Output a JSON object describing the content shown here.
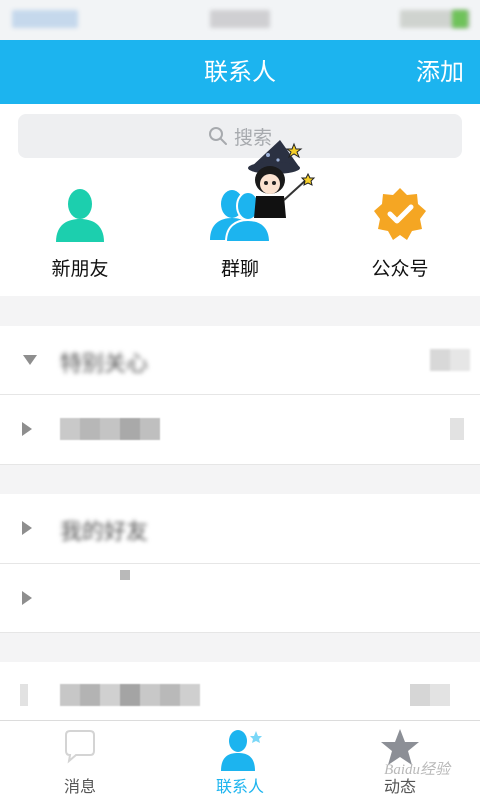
{
  "header": {
    "title": "联系人",
    "add_label": "添加"
  },
  "search": {
    "placeholder": "搜索"
  },
  "shortcuts": [
    {
      "label": "新朋友",
      "icon": "person-icon"
    },
    {
      "label": "群聊",
      "icon": "group-chat-icon"
    },
    {
      "label": "公众号",
      "icon": "official-account-icon"
    }
  ],
  "groups": [
    {
      "name": "特别关心",
      "expanded": true
    },
    {
      "name": "",
      "expanded": false
    },
    {
      "name": "我的好友",
      "expanded": false
    },
    {
      "name": "",
      "expanded": false
    },
    {
      "name": "",
      "expanded": false
    }
  ],
  "tabs": [
    {
      "label": "消息",
      "icon": "message-icon",
      "active": false
    },
    {
      "label": "联系人",
      "icon": "contacts-icon",
      "active": true
    },
    {
      "label": "动态",
      "icon": "star-icon",
      "active": false
    }
  ],
  "watermark": "Baidu经验",
  "colors": {
    "brand": "#1cb4ef",
    "teal": "#1ccfae",
    "orange": "#f5a623"
  }
}
